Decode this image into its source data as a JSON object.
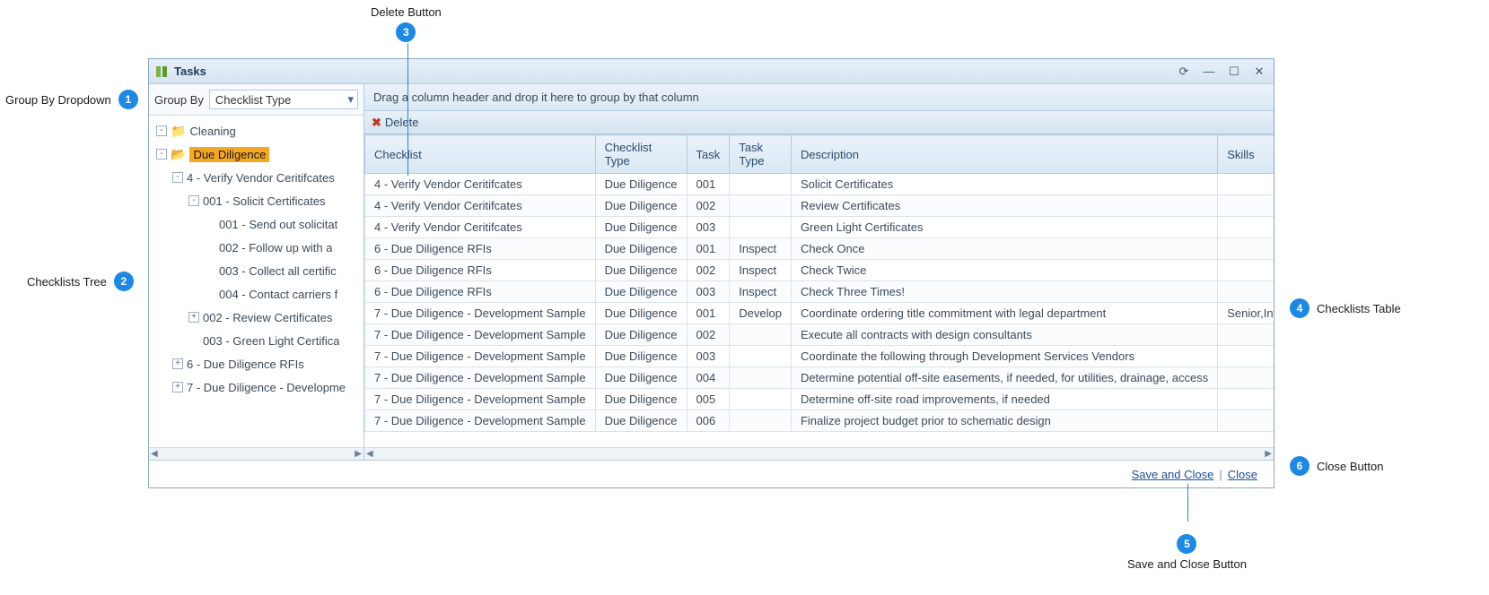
{
  "window": {
    "title": "Tasks"
  },
  "groupby": {
    "label": "Group By",
    "value": "Checklist Type"
  },
  "tree": {
    "items": [
      {
        "label": "Cleaning",
        "icon": "folder",
        "expander": "-",
        "depth": 0
      },
      {
        "label": "Due Diligence",
        "icon": "folder-open",
        "expander": "-",
        "depth": 0,
        "selected": true
      },
      {
        "label": "4 - Verify Vendor Ceritifcates",
        "expander": "-",
        "depth": 1
      },
      {
        "label": "001 - Solicit Certificates",
        "expander": "-",
        "depth": 2
      },
      {
        "label": "001 - Send out solicitat",
        "expander": "",
        "depth": 3
      },
      {
        "label": "002 - Follow up with a",
        "expander": "",
        "depth": 3
      },
      {
        "label": "003 - Collect all certific",
        "expander": "",
        "depth": 3
      },
      {
        "label": "004 - Contact carriers f",
        "expander": "",
        "depth": 3
      },
      {
        "label": "002 - Review Certificates",
        "expander": "+",
        "depth": 2
      },
      {
        "label": "003 - Green Light Certifica",
        "expander": "",
        "depth": 2
      },
      {
        "label": "6 - Due Diligence RFIs",
        "expander": "+",
        "depth": 1
      },
      {
        "label": "7 - Due Diligence - Developme",
        "expander": "+",
        "depth": 1
      }
    ]
  },
  "grid": {
    "group_hint": "Drag a column header and drop it here to group by that column",
    "delete_label": "Delete",
    "columns": [
      "Checklist",
      "Checklist Type",
      "Task",
      "Task Type",
      "Description",
      "Skills"
    ],
    "rows": [
      {
        "checklist": "4 - Verify Vendor Ceritifcates",
        "ctype": "Due Diligence",
        "task": "001",
        "ttype": "",
        "desc": "Solicit Certificates",
        "skills": ""
      },
      {
        "checklist": "4 - Verify Vendor Ceritifcates",
        "ctype": "Due Diligence",
        "task": "002",
        "ttype": "",
        "desc": "Review Certificates",
        "skills": ""
      },
      {
        "checklist": "4 - Verify Vendor Ceritifcates",
        "ctype": "Due Diligence",
        "task": "003",
        "ttype": "",
        "desc": "Green Light Certificates",
        "skills": ""
      },
      {
        "checklist": "6 - Due Diligence RFIs",
        "ctype": "Due Diligence",
        "task": "001",
        "ttype": "Inspect",
        "desc": "Check Once",
        "skills": ""
      },
      {
        "checklist": "6 - Due Diligence RFIs",
        "ctype": "Due Diligence",
        "task": "002",
        "ttype": "Inspect",
        "desc": "Check Twice",
        "skills": ""
      },
      {
        "checklist": "6 - Due Diligence RFIs",
        "ctype": "Due Diligence",
        "task": "003",
        "ttype": "Inspect",
        "desc": "Check Three Times!",
        "skills": ""
      },
      {
        "checklist": "7 - Due Diligence - Development Sample",
        "ctype": "Due Diligence",
        "task": "001",
        "ttype": "Develop",
        "desc": "Coordinate ordering title commitment with legal department",
        "skills": "Senior,Intermediate"
      },
      {
        "checklist": "7 - Due Diligence - Development Sample",
        "ctype": "Due Diligence",
        "task": "002",
        "ttype": "",
        "desc": "Execute all contracts with design consultants",
        "skills": ""
      },
      {
        "checklist": "7 - Due Diligence - Development Sample",
        "ctype": "Due Diligence",
        "task": "003",
        "ttype": "",
        "desc": "Coordinate the following through Development Services Vendors",
        "skills": ""
      },
      {
        "checklist": "7 - Due Diligence - Development Sample",
        "ctype": "Due Diligence",
        "task": "004",
        "ttype": "",
        "desc": "Determine potential off-site easements, if needed, for utilities, drainage, access",
        "skills": ""
      },
      {
        "checklist": "7 - Due Diligence - Development Sample",
        "ctype": "Due Diligence",
        "task": "005",
        "ttype": "",
        "desc": "Determine off-site road improvements, if needed",
        "skills": ""
      },
      {
        "checklist": "7 - Due Diligence - Development Sample",
        "ctype": "Due Diligence",
        "task": "006",
        "ttype": "",
        "desc": "Finalize project budget prior to schematic design",
        "skills": ""
      }
    ]
  },
  "footer": {
    "save_close": "Save and Close",
    "sep": "|",
    "close": "Close"
  },
  "annotations": {
    "a1": {
      "num": "1",
      "label": "Group By Dropdown"
    },
    "a2": {
      "num": "2",
      "label": "Checklists Tree"
    },
    "a3": {
      "num": "3",
      "label": "Delete Button"
    },
    "a4": {
      "num": "4",
      "label": "Checklists Table"
    },
    "a5": {
      "num": "5",
      "label": "Save and Close Button"
    },
    "a6": {
      "num": "6",
      "label": "Close Button"
    }
  }
}
